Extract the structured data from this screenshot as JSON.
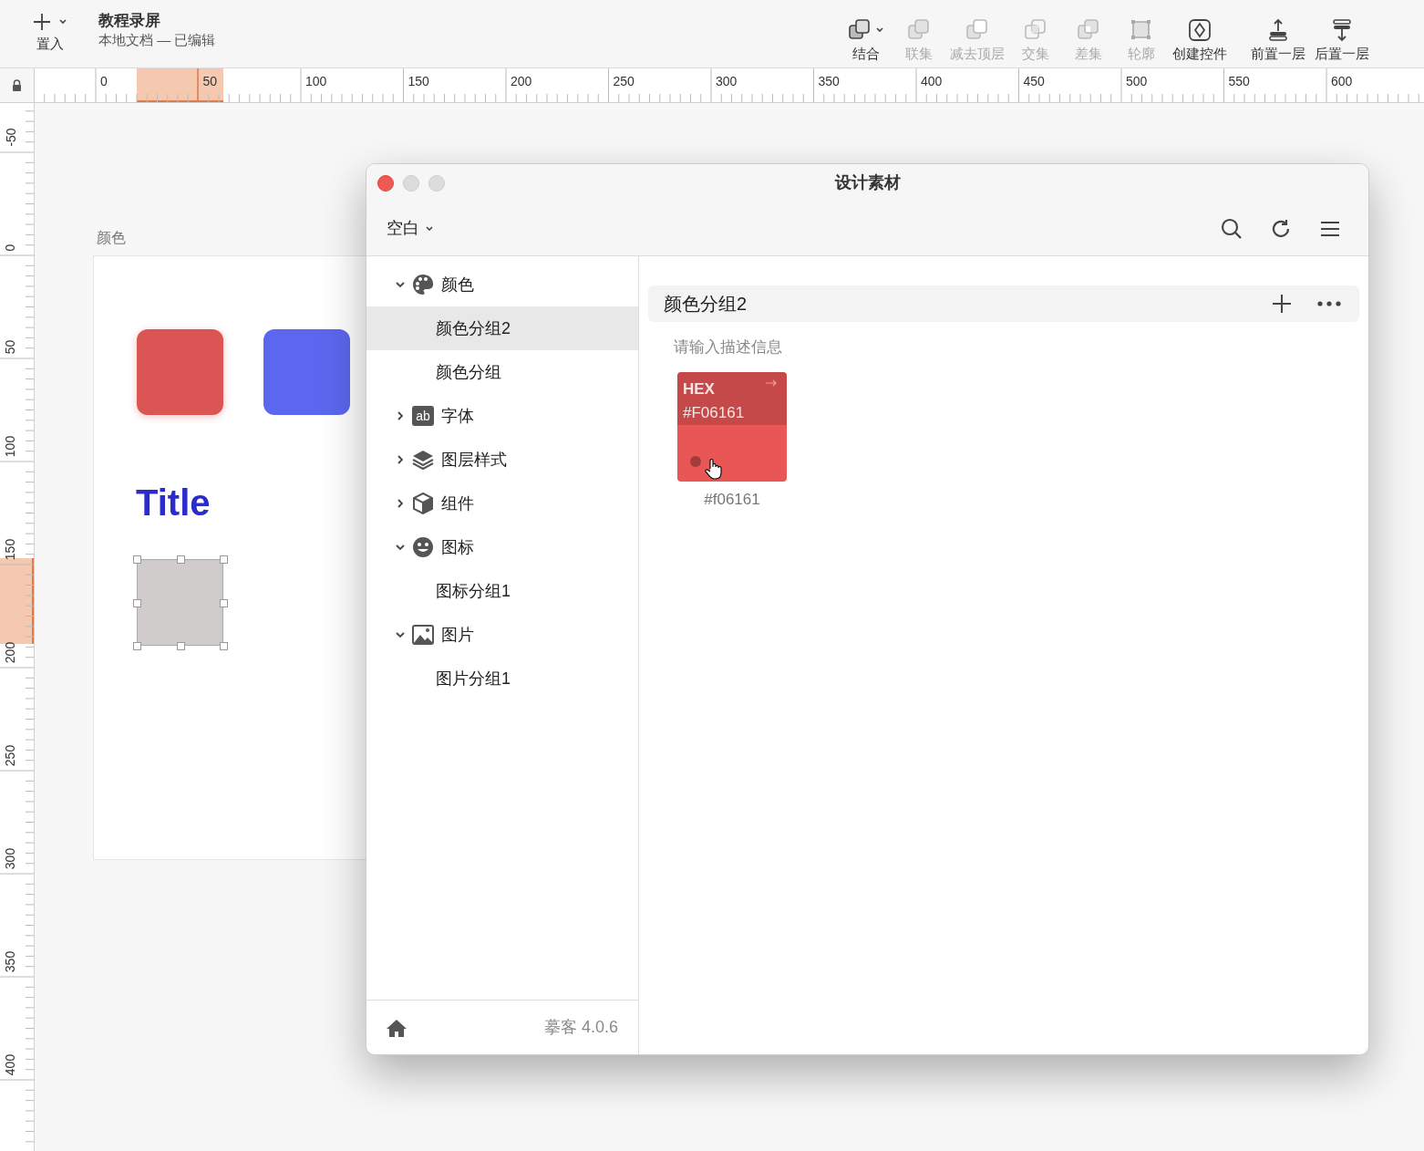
{
  "toolbar": {
    "insert": {
      "label": "置入"
    },
    "document": {
      "title": "教程录屏",
      "subtitle": "本地文档 — 已编辑"
    },
    "tools": [
      {
        "kind": "combine",
        "label": "结合",
        "disabled": false,
        "dropdown": true
      },
      {
        "kind": "union",
        "label": "联集",
        "disabled": true,
        "dropdown": false
      },
      {
        "kind": "subtract",
        "label": "减去顶层",
        "disabled": true,
        "dropdown": false
      },
      {
        "kind": "intersect",
        "label": "交集",
        "disabled": true,
        "dropdown": false
      },
      {
        "kind": "difference",
        "label": "差集",
        "disabled": true,
        "dropdown": false
      },
      {
        "kind": "outline",
        "label": "轮廓",
        "disabled": true,
        "dropdown": false
      },
      {
        "kind": "component",
        "label": "创建控件",
        "disabled": false,
        "dropdown": false
      },
      {
        "kind": "forward",
        "label": "前置一层",
        "disabled": false,
        "dropdown": false
      },
      {
        "kind": "backward",
        "label": "后置一层",
        "disabled": false,
        "dropdown": false
      }
    ]
  },
  "rulers": {
    "horizontal": [
      "0",
      "50",
      "100",
      "150",
      "200",
      "250",
      "300",
      "350",
      "400",
      "450",
      "500",
      "550",
      "600"
    ],
    "vertical": [
      "-50",
      "0",
      "50",
      "100",
      "150",
      "200",
      "250",
      "300",
      "350",
      "400"
    ]
  },
  "canvas": {
    "artboard_label": "颜色",
    "title_text": "Title"
  },
  "window": {
    "title": "设计素材",
    "library": "空白",
    "tree": [
      {
        "kind": "palette",
        "label": "颜色",
        "expanded": true,
        "selected": false,
        "children": [
          {
            "label": "颜色分组2",
            "selected": true
          },
          {
            "label": "颜色分组",
            "selected": false
          }
        ]
      },
      {
        "kind": "text",
        "icon_text": "ab",
        "label": "字体",
        "expanded": false,
        "selected": false
      },
      {
        "kind": "layers",
        "label": "图层样式",
        "expanded": false,
        "selected": false
      },
      {
        "kind": "cube",
        "label": "组件",
        "expanded": false,
        "selected": false
      },
      {
        "kind": "smiley",
        "label": "图标",
        "expanded": true,
        "selected": false,
        "children": [
          {
            "label": "图标分组1",
            "selected": false
          }
        ]
      },
      {
        "kind": "image",
        "label": "图片",
        "expanded": true,
        "selected": false,
        "children": [
          {
            "label": "图片分组1",
            "selected": false
          }
        ]
      }
    ],
    "group": {
      "title": "颜色分组2",
      "description_placeholder": "请输入描述信息",
      "swatches": [
        {
          "format": "HEX",
          "value": "#F06161",
          "caption": "#f06161",
          "color": "#e85656"
        }
      ]
    },
    "footer": {
      "version": "摹客 4.0.6"
    }
  }
}
